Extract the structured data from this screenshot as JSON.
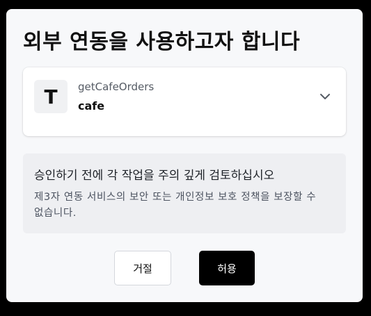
{
  "dialog": {
    "title": "외부 연동을 사용하고자 합니다"
  },
  "tool": {
    "avatar_letter": "T",
    "name": "getCafeOrders",
    "app": "cafe",
    "expand_icon": "chevron-down-icon"
  },
  "notice": {
    "title": "승인하기 전에 각 작업을 주의 깊게 검토하십시오",
    "body": "제3자 연동 서비스의 보안 또는 개인정보 보호 정책을 보장할 수 없습니다."
  },
  "actions": {
    "deny_label": "거절",
    "allow_label": "허용"
  },
  "colors": {
    "overlay": "#000000",
    "dialog_bg": "#f7f8fa",
    "card_bg": "#ffffff",
    "notice_bg": "#eeeff2",
    "primary_button": "#000000"
  }
}
